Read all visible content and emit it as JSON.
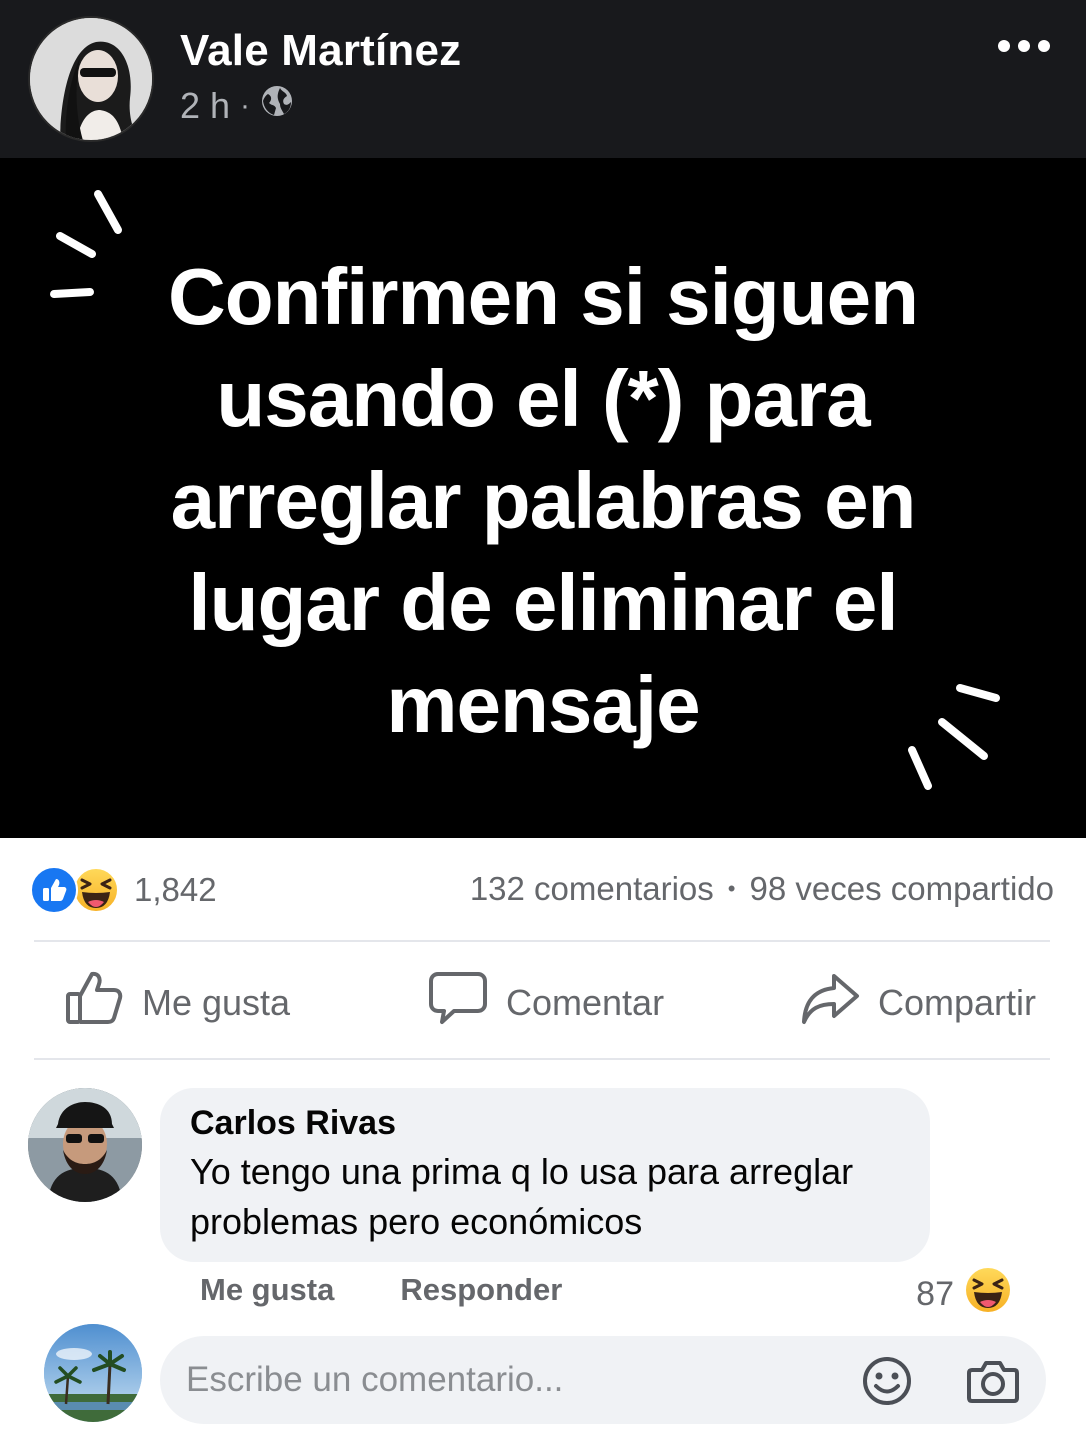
{
  "post": {
    "author": "Vale Martínez",
    "time": "2 h",
    "separator": "·",
    "privacy_icon": "globe-icon",
    "more_icon": "more-dots-icon",
    "image_text": "Confirmen si siguen usando el (*) para arreglar palabras en lugar de eliminar el mensaje"
  },
  "stats": {
    "reaction_icons": [
      "like-reaction-icon",
      "haha-reaction-icon"
    ],
    "reaction_count": "1,842",
    "comments": "132 comentarios",
    "dot": "•",
    "shares": "98 veces compartido"
  },
  "actions": {
    "like": "Me gusta",
    "comment": "Comentar",
    "share": "Compartir"
  },
  "comment": {
    "author": "Carlos Rivas",
    "text": "Yo tengo una prima q lo usa para arreglar problemas pero económicos",
    "like": "Me gusta",
    "reply": "Responder",
    "reaction_count": "87",
    "reaction_icon": "haha-reaction-icon"
  },
  "composer": {
    "placeholder": "Escribe un comentario...",
    "emoji_icon": "emoji-icon",
    "camera_icon": "camera-icon"
  },
  "colors": {
    "header_bg": "#18191c",
    "accent": "#1877f2",
    "muted": "#65676b",
    "bubble": "#f0f2f5"
  }
}
